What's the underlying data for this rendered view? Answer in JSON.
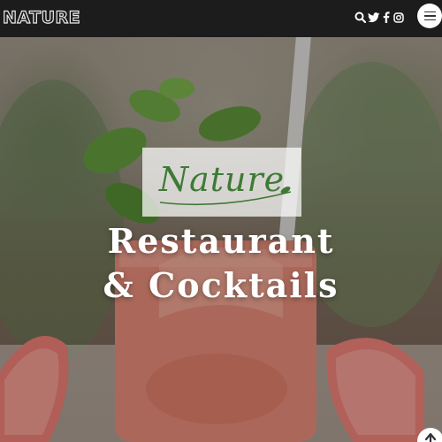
{
  "brand": {
    "logo_text": "Nature"
  },
  "nav": {
    "icons": [
      {
        "name": "search-icon"
      },
      {
        "name": "twitter-icon"
      },
      {
        "name": "facebook-icon"
      },
      {
        "name": "instagram-icon"
      }
    ],
    "menu_icon": "hamburger-menu-icon"
  },
  "hero": {
    "script_title": "Nature",
    "headline_line1": "Restaurant",
    "headline_line2": "& Cocktails"
  },
  "back_to_top": {
    "icon": "arrow-up-icon"
  },
  "colors": {
    "navbar": "#1c1c1c",
    "script_green": "#3e7a35",
    "headline": "#ffffff",
    "drink": "#e8877a"
  }
}
